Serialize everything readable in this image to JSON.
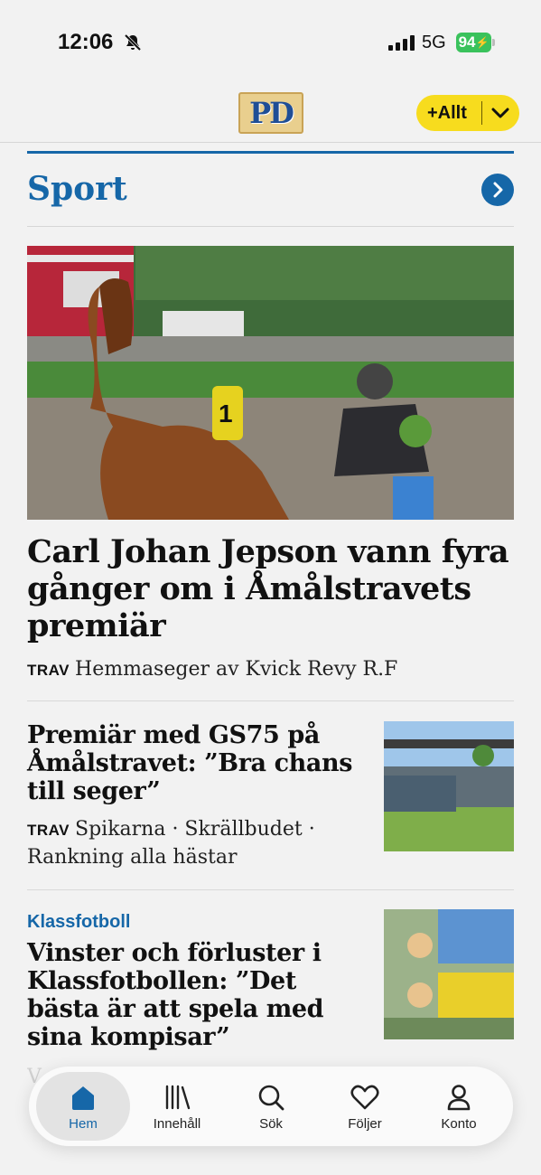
{
  "status_bar": {
    "time": "12:06",
    "network": "5G",
    "battery": "94"
  },
  "header": {
    "logo_text": "PD",
    "allt_label": "+Allt"
  },
  "section": {
    "title": "Sport"
  },
  "articles": [
    {
      "headline": "Carl Johan Jepson vann fyra gånger om i Åmålstravets premiär",
      "tag": "TRAV",
      "teaser": "Hemmaseger av Kvick Revy R.F"
    },
    {
      "headline": "Premiär med GS75 på Åmålstravet: ”Bra chans till seger”",
      "tag": "TRAV",
      "teaser": "Spikarna · Skrällbudet · Rankning alla hästar"
    },
    {
      "kicker": "Klassfotboll",
      "headline": "Vinster och förluster i Klassfotbollen: ”Det bästa är att spela med sina kompisar”"
    }
  ],
  "bottom_nav": [
    {
      "label": "Hem",
      "icon": "home-icon",
      "active": true
    },
    {
      "label": "Innehåll",
      "icon": "library-icon",
      "active": false
    },
    {
      "label": "Sök",
      "icon": "search-icon",
      "active": false
    },
    {
      "label": "Följer",
      "icon": "heart-icon",
      "active": false
    },
    {
      "label": "Konto",
      "icon": "person-icon",
      "active": false
    }
  ],
  "colors": {
    "accent": "#1667a8",
    "allt_button": "#f7dc1e",
    "battery": "#3ac25c"
  }
}
